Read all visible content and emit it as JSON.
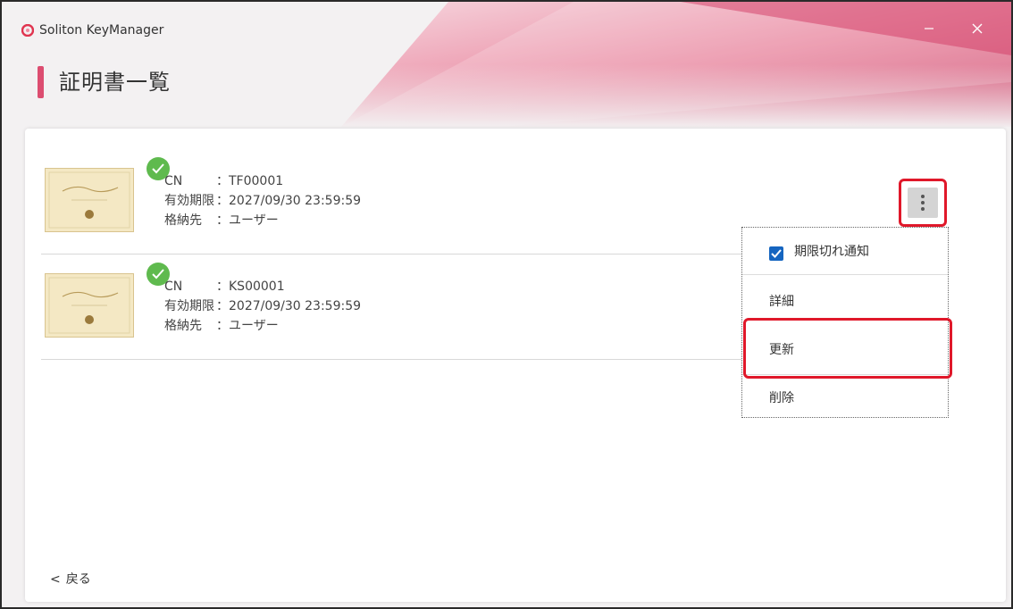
{
  "window": {
    "title": "Soliton KeyManager",
    "minimize_icon": "minimize-icon",
    "close_icon": "close-icon",
    "brand_color": "#dc4d70"
  },
  "page": {
    "title": "証明書一覧"
  },
  "certificates": [
    {
      "cn_label": "CN",
      "cn_value": "：TF00001",
      "expiry_label": "有効期限",
      "expiry_value": "：2027/09/30 23:59:59",
      "store_label": "格納先",
      "store_value": "：ユーザー",
      "status": "valid-check-icon"
    },
    {
      "cn_label": "CN",
      "cn_value": "：KS00001",
      "expiry_label": "有効期限",
      "expiry_value": "：2027/09/30 23:59:59",
      "store_label": "格納先",
      "store_value": "：ユーザー",
      "status": "valid-check-icon"
    }
  ],
  "menu": {
    "expiry_notice": "期限切れ通知",
    "expiry_notice_checked": true,
    "details": "詳細",
    "renew": "更新",
    "delete": "削除"
  },
  "footer": {
    "back_chevron": "<",
    "back_label": "戻る"
  },
  "colors": {
    "highlight": "#e0182a",
    "check": "#5fba4e",
    "checkbox": "#1565c0"
  }
}
